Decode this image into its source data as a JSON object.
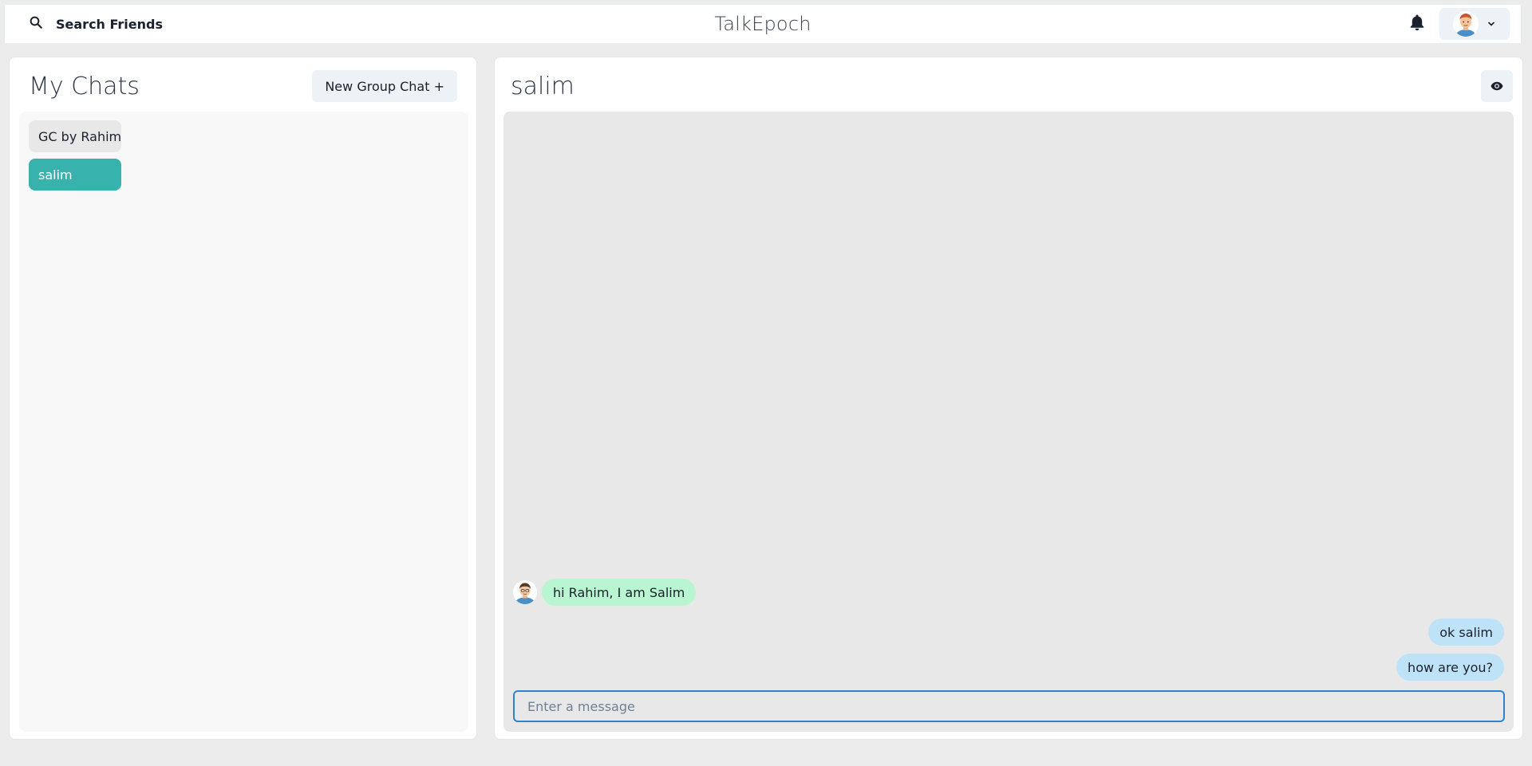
{
  "topbar": {
    "search_label": "Search Friends",
    "app_title": "TalkEpoch"
  },
  "sidebar": {
    "title": "My Chats",
    "new_group_label": "New Group Chat +",
    "chats": [
      {
        "label": "GC by Rahim",
        "active": false
      },
      {
        "label": "salim",
        "active": true
      }
    ]
  },
  "chat": {
    "name": "salim",
    "messages": [
      {
        "text": "hi Rahim, I am Salim",
        "direction": "incoming"
      },
      {
        "text": "ok salim",
        "direction": "outgoing"
      },
      {
        "text": "how are you?",
        "direction": "outgoing"
      }
    ],
    "input_placeholder": "Enter a message",
    "input_value": ""
  },
  "colors": {
    "accent": "#38b2ac",
    "incoming_bubble": "#b9f5d0",
    "outgoing_bubble": "#bee3f8",
    "input_border": "#3182ce"
  },
  "icons": {
    "search": "search-icon",
    "bell": "bell-icon",
    "avatar": "user-avatar",
    "chevron": "chevron-down-icon",
    "eye": "eye-icon"
  }
}
